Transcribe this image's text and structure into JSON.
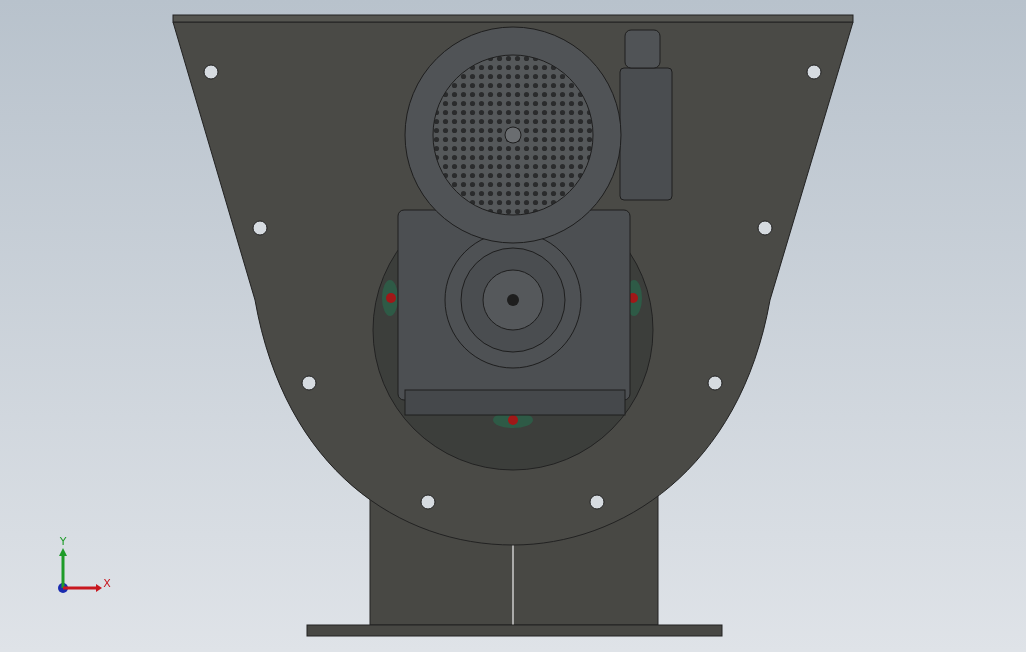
{
  "viewport": {
    "triad": {
      "axes": [
        {
          "kind": "vertical",
          "label": "Y",
          "color": "#1e9b28"
        },
        {
          "kind": "horizontal",
          "label": "X",
          "color": "#c8171f"
        }
      ]
    }
  }
}
